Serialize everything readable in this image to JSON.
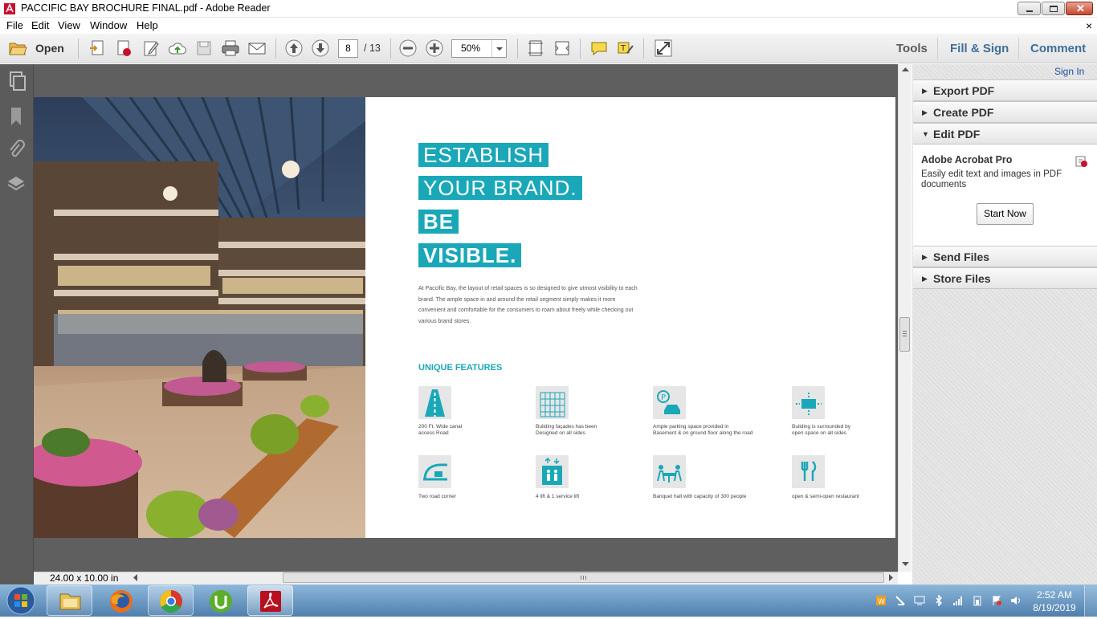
{
  "window": {
    "title": "PACCIFIC BAY BROCHURE FINAL.pdf - Adobe Reader"
  },
  "menu": [
    "File",
    "Edit",
    "View",
    "Window",
    "Help"
  ],
  "menu_close_glyph": "×",
  "toolbar": {
    "open_label": "Open",
    "page_current": "8",
    "page_total": "/ 13",
    "zoom": "50%"
  },
  "right_tabs": {
    "tools": "Tools",
    "fill_sign": "Fill & Sign",
    "comment": "Comment"
  },
  "right_panel": {
    "sign_in": "Sign In",
    "sections_top": [
      "Export PDF",
      "Create PDF",
      "Edit PDF"
    ],
    "acrobat": {
      "title": "Adobe Acrobat Pro",
      "description": "Easily edit text and images in PDF documents",
      "button": "Start Now"
    },
    "sections_bottom": [
      "Send Files",
      "Store Files"
    ]
  },
  "status": {
    "page_size": "24.00 x 10.00 in"
  },
  "document": {
    "headline": [
      "ESTABLISH",
      "YOUR BRAND.",
      "BE",
      "VISIBLE."
    ],
    "body": "At Paccific Bay, the layout of retail spaces is so designed to give utmost visibility to each brand. The ample space in and around the retail segment simply makes it more convenient and comfortable for the consumers to roam about freely while checking out various brand stores.",
    "features_title": "UNIQUE FEATURES",
    "features": [
      {
        "icon": "road-icon",
        "text": [
          "200 Ft. Wide canal",
          "access Road"
        ]
      },
      {
        "icon": "building-facade-icon",
        "text": [
          "Building façades has been",
          "Designed on all sides"
        ]
      },
      {
        "icon": "parking-icon",
        "text": [
          "Ample parking space provided in",
          "Basement & on ground floor along the road"
        ]
      },
      {
        "icon": "open-space-icon",
        "text": [
          "Building is surrounded by",
          "open space on all sides"
        ]
      },
      {
        "icon": "road-corner-icon",
        "text": [
          "Two road corner"
        ]
      },
      {
        "icon": "lift-icon",
        "text": [
          "4 lift & 1 service lift"
        ]
      },
      {
        "icon": "banquet-icon",
        "text": [
          "Banquet hall with capacity of 300 people"
        ]
      },
      {
        "icon": "restaurant-icon",
        "text": [
          "open & semi-open restaurant"
        ]
      }
    ]
  },
  "taskbar": {
    "apps": [
      "file-explorer",
      "firefox",
      "chrome",
      "utorrent",
      "adobe-reader"
    ],
    "time": "2:52 AM",
    "date": "8/19/2019"
  },
  "colors": {
    "accent_teal": "#1aa8b8",
    "link_blue": "#3f6f9a"
  }
}
